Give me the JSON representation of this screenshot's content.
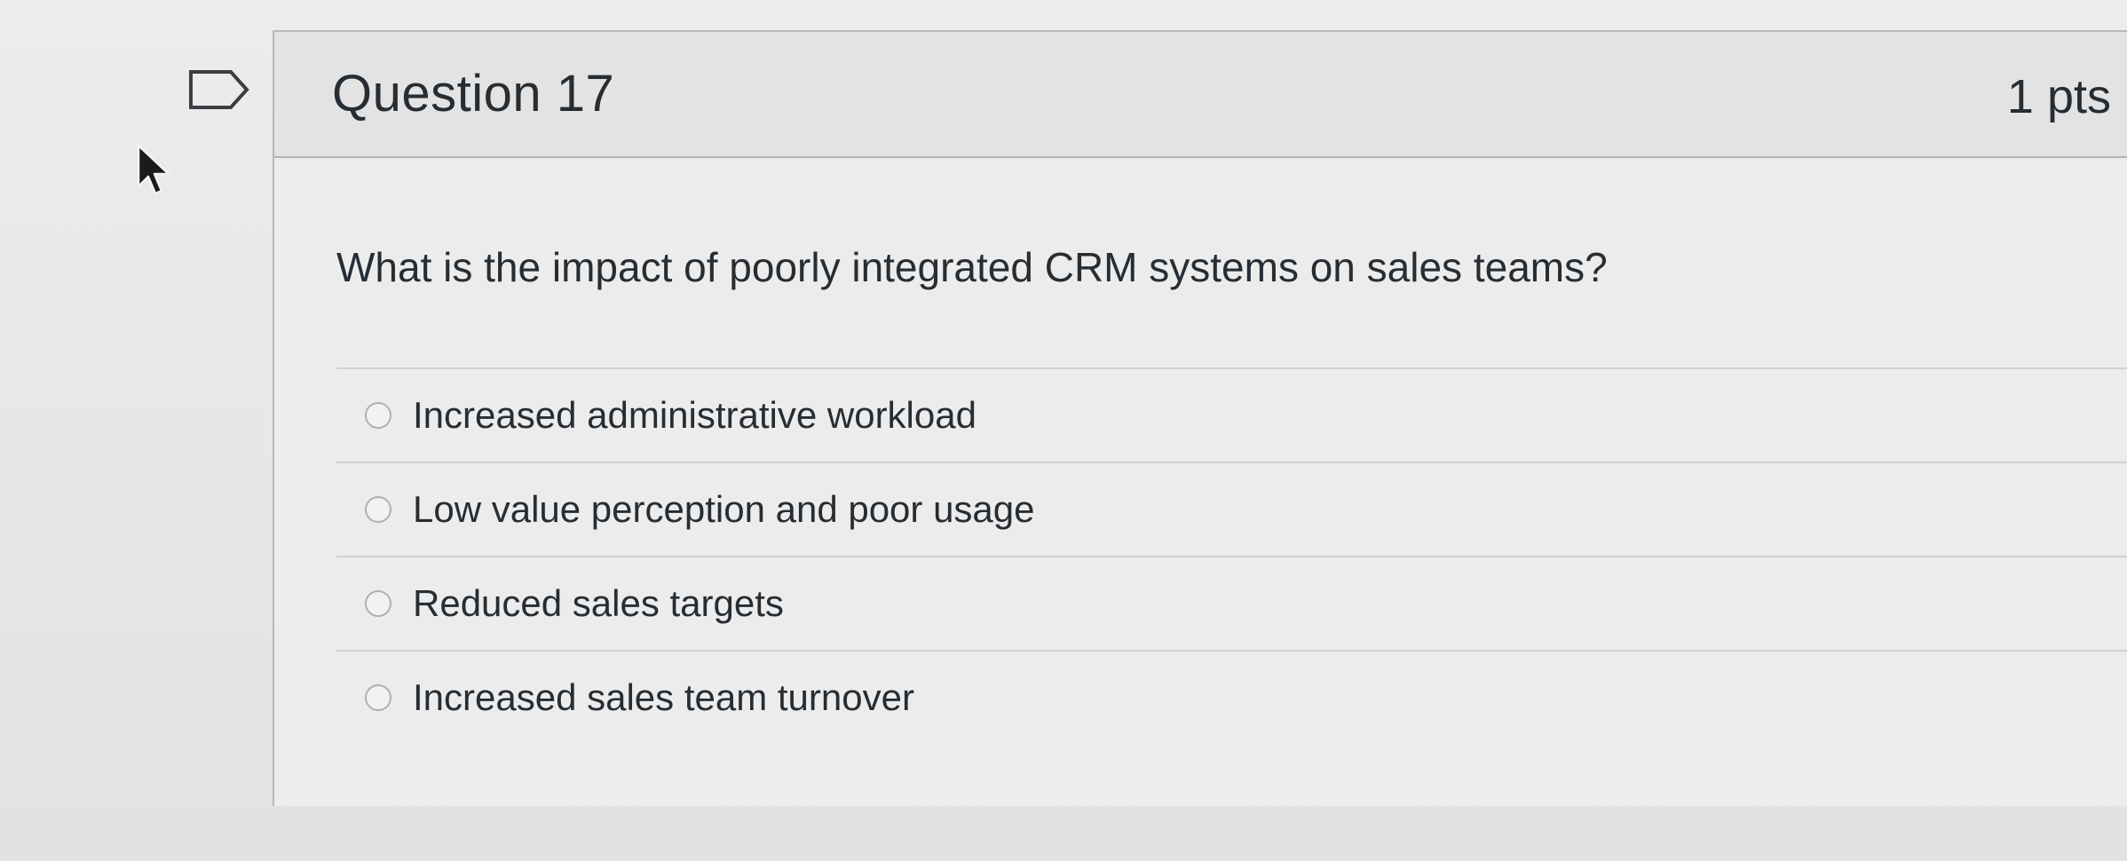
{
  "question": {
    "title": "Question 17",
    "points": "1 pts",
    "text": "What is the impact of poorly integrated CRM systems on sales teams?",
    "answers": [
      {
        "label": "Increased administrative workload"
      },
      {
        "label": "Low value perception and poor usage"
      },
      {
        "label": "Reduced sales targets"
      },
      {
        "label": "Increased sales team turnover"
      }
    ]
  },
  "icons": {
    "flag": "flag-icon",
    "cursor": "cursor-icon"
  },
  "colors": {
    "text": "#262d33",
    "border": "#b9b9b9",
    "background": "#ebebeb"
  }
}
